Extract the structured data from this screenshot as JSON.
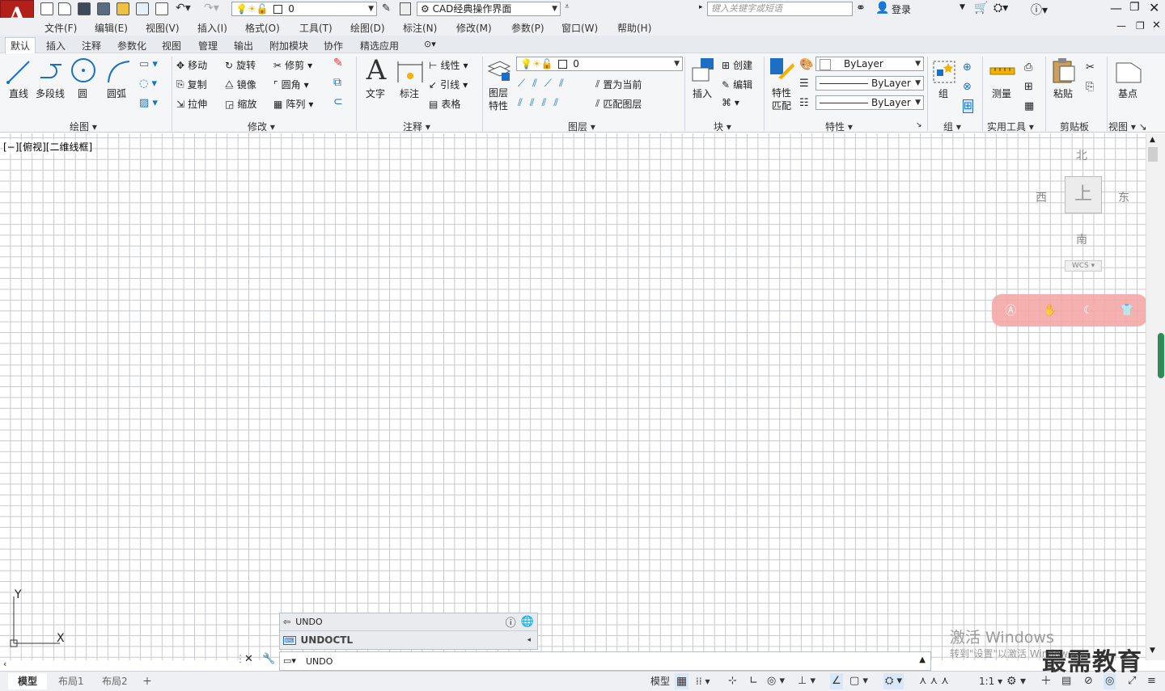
{
  "app": {
    "logo": "A"
  },
  "quick_access": {
    "layer_value": "0",
    "workspace": "CAD经典操作界面",
    "search_placeholder": "键入关键字或短语",
    "login": "登录"
  },
  "menu": [
    "文件(F)",
    "编辑(E)",
    "视图(V)",
    "插入(I)",
    "格式(O)",
    "工具(T)",
    "绘图(D)",
    "标注(N)",
    "修改(M)",
    "参数(P)",
    "窗口(W)",
    "帮助(H)"
  ],
  "ribbon_tabs": [
    "默认",
    "插入",
    "注释",
    "参数化",
    "视图",
    "管理",
    "输出",
    "附加模块",
    "协作",
    "精选应用"
  ],
  "panels": {
    "draw": {
      "title": "绘图",
      "line": "直线",
      "polyline": "多段线",
      "circle": "圆",
      "arc": "圆弧"
    },
    "modify": {
      "title": "修改",
      "move": "移动",
      "rotate": "旋转",
      "trim": "修剪",
      "copy": "复制",
      "mirror": "镜像",
      "fillet": "圆角",
      "stretch": "拉伸",
      "scale": "缩放",
      "array": "阵列"
    },
    "annotation": {
      "title": "注释",
      "text": "文字",
      "dim": "标注",
      "linear": "线性",
      "leader": "引线",
      "table": "表格"
    },
    "layers": {
      "title": "图层",
      "props_line1": "图层",
      "props_line2": "特性",
      "current_layer": "0",
      "set_current": "置为当前",
      "match_layer": "匹配图层"
    },
    "block": {
      "title": "块",
      "insert": "插入",
      "create": "创建",
      "edit": "编辑"
    },
    "properties": {
      "title": "特性",
      "match_line1": "特性",
      "match_line2": "匹配",
      "color": "ByLayer",
      "linetype": "ByLayer",
      "lineweight": "ByLayer"
    },
    "groups": {
      "title": "组",
      "group": "组"
    },
    "utilities": {
      "title": "实用工具",
      "measure": "测量"
    },
    "clipboard": {
      "title": "剪贴板",
      "paste": "粘贴"
    },
    "view": {
      "title": "视图",
      "base": "基点"
    }
  },
  "viewport": {
    "label": "[−][俯视][二维线框]"
  },
  "viewcube": {
    "north": "北",
    "south": "南",
    "east": "东",
    "west": "西",
    "top": "上",
    "wcs": "WCS"
  },
  "ucs": {
    "x": "X",
    "y": "Y"
  },
  "command": {
    "history": [
      {
        "text": "UNDO"
      },
      {
        "text": "UNDOCTL"
      }
    ],
    "input": "UNDO"
  },
  "layout_tabs": [
    "模型",
    "布局1",
    "布局2"
  ],
  "status": {
    "model": "模型",
    "scale": "1:1"
  },
  "watermarks": {
    "windows_line1": "激活 Windows",
    "windows_line2": "转到\"设置\"以激活 Windows。",
    "brand": "最需教育"
  },
  "colors": {
    "accent": "#b22019",
    "grid": "#c7c9cc",
    "active_tab": "#ffffff"
  }
}
